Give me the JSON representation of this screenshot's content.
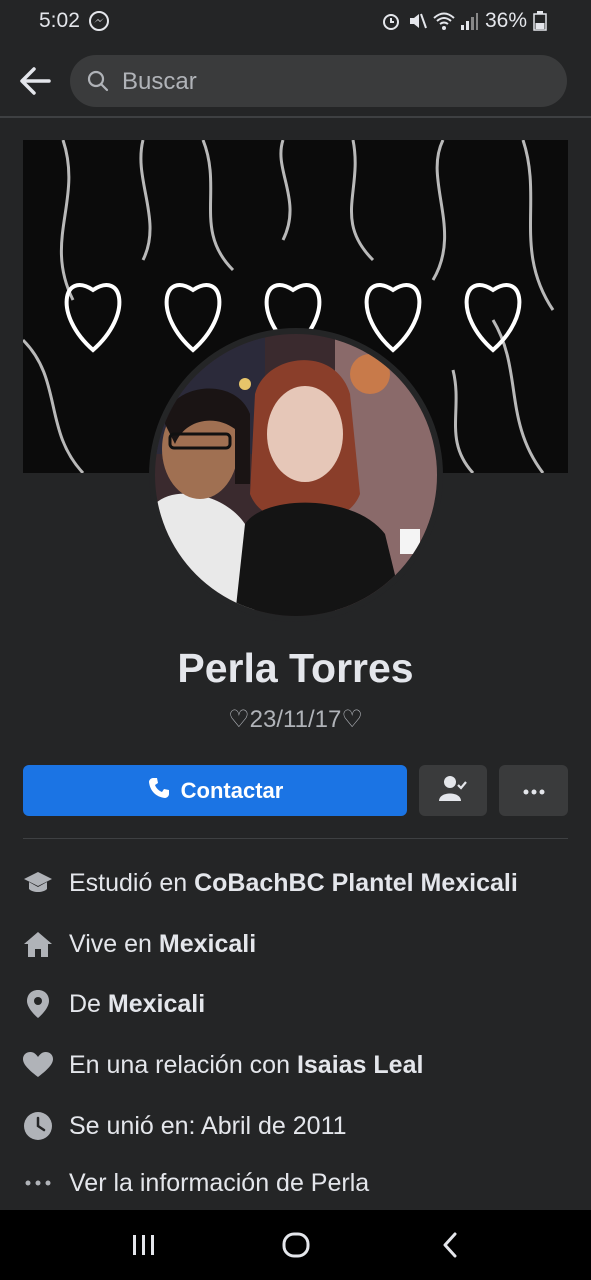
{
  "status": {
    "time": "5:02",
    "battery": "36%",
    "icons": [
      "messenger-icon",
      "alarm-icon",
      "mute-icon",
      "wifi-icon",
      "signal-icon",
      "battery-icon"
    ]
  },
  "search": {
    "placeholder": "Buscar"
  },
  "profile": {
    "name": "Perla Torres",
    "bio": "♡23/11/17♡"
  },
  "actions": {
    "contact_label": "Contactar",
    "friend_icon": "person-check-icon",
    "more_icon": "more-dots-icon"
  },
  "info": {
    "studied_prefix": "Estudió en ",
    "studied_value": "CoBachBC Plantel Mexicali",
    "lives_prefix": "Vive en ",
    "lives_value": "Mexicali",
    "from_prefix": "De ",
    "from_value": "Mexicali",
    "relationship_prefix": "En una relación con ",
    "relationship_value": "Isaias Leal",
    "joined": "Se unió en: Abril de 2011",
    "see_more": "Ver la información de Perla"
  },
  "colors": {
    "background": "#242526",
    "primary": "#1b74e4",
    "secondary_button": "#3a3b3c"
  }
}
